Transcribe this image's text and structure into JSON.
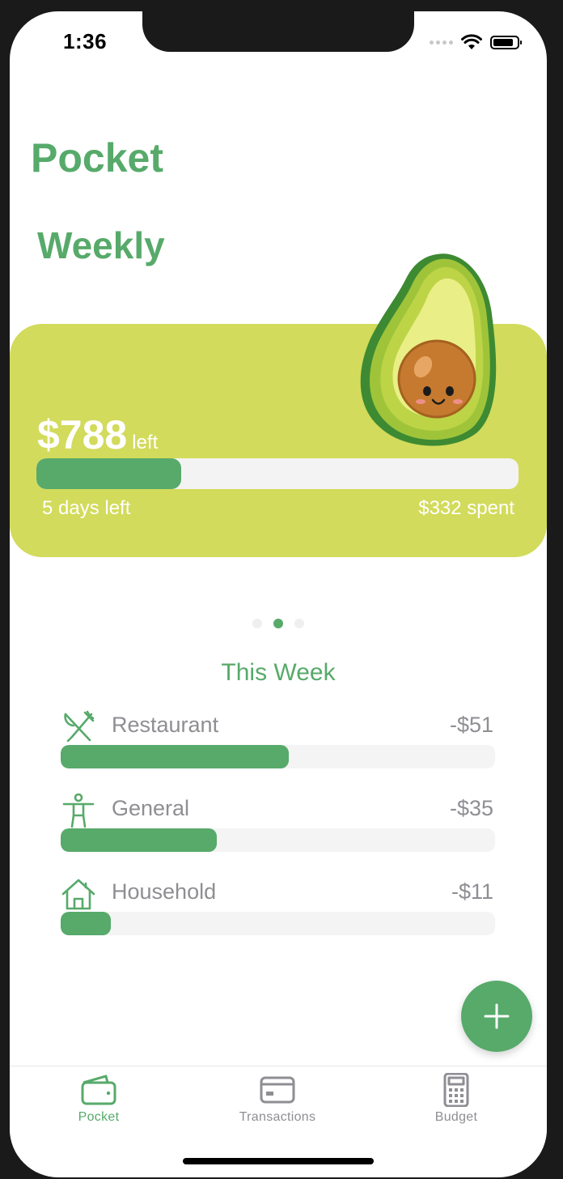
{
  "status_bar": {
    "time": "1:36"
  },
  "app_title": "Pocket",
  "section_title": "Weekly",
  "weekly_card": {
    "amount": "$788",
    "amount_suffix": "left",
    "progress_fraction": 0.3,
    "days_left": "5 days left",
    "spent": "$332 spent",
    "background_color": "#d2db5b"
  },
  "pager": {
    "count": 3,
    "active_index": 1
  },
  "this_week": {
    "title": "This Week",
    "categories": [
      {
        "name": "Restaurant",
        "amount": "-$51",
        "fraction": 0.525,
        "icon": "fork-knife-icon"
      },
      {
        "name": "General",
        "amount": "-$35",
        "fraction": 0.36,
        "icon": "person-icon"
      },
      {
        "name": "Household",
        "amount": "-$11",
        "fraction": 0.115,
        "icon": "house-icon"
      }
    ]
  },
  "fab": {
    "icon": "plus-icon"
  },
  "tabbar": {
    "tabs": [
      {
        "label": "Pocket",
        "icon": "wallet-icon",
        "active": true
      },
      {
        "label": "Transactions",
        "icon": "credit-card-icon",
        "active": false
      },
      {
        "label": "Budget",
        "icon": "calculator-icon",
        "active": false
      }
    ]
  },
  "colors": {
    "accent": "#57aa6a",
    "inactive": "#8e8e93",
    "track": "#f4f4f4"
  }
}
